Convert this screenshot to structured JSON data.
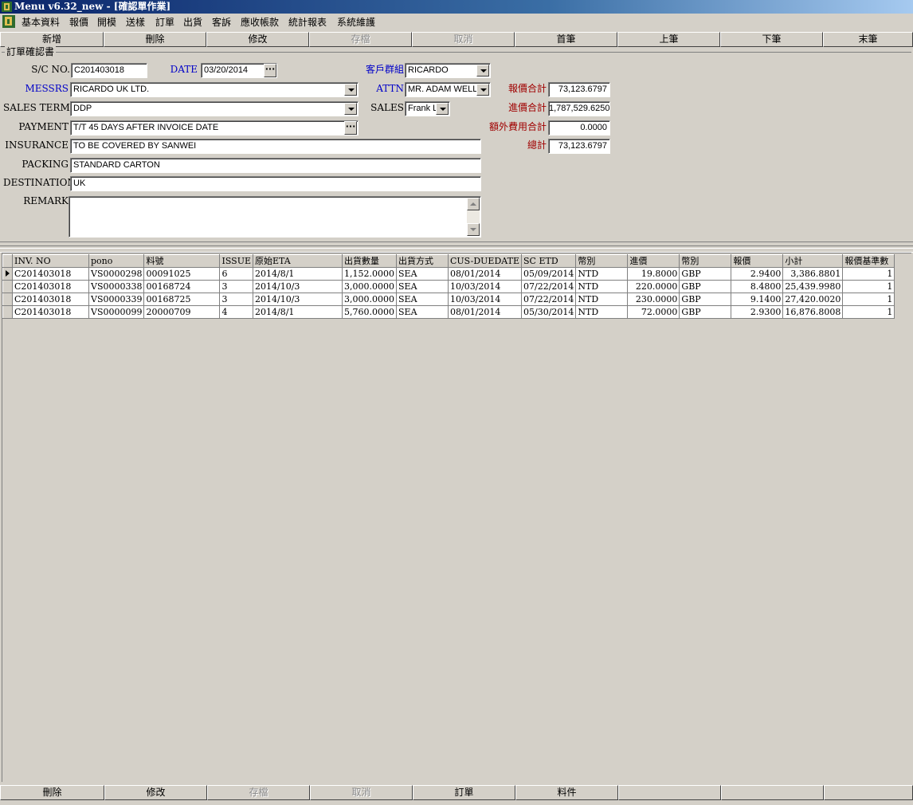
{
  "window": {
    "title": "Menu v6.32_new - [確認單作業]"
  },
  "menu": [
    "基本資料",
    "報價",
    "開模",
    "送樣",
    "訂單",
    "出貨",
    "客訴",
    "應收帳款",
    "統計報表",
    "系統維護"
  ],
  "toolbar": [
    {
      "label": "新增",
      "enabled": true
    },
    {
      "label": "刪除",
      "enabled": true
    },
    {
      "label": "修改",
      "enabled": true
    },
    {
      "label": "存檔",
      "enabled": false
    },
    {
      "label": "取消",
      "enabled": false
    },
    {
      "label": "首筆",
      "enabled": true
    },
    {
      "label": "上筆",
      "enabled": true
    },
    {
      "label": "下筆",
      "enabled": true
    },
    {
      "label": "末筆",
      "enabled": true
    }
  ],
  "form": {
    "group_title": "訂單確認書",
    "sc_no_label": "S/C NO.",
    "sc_no": "C201403018",
    "date_label": "DATE",
    "date": "03/20/2014",
    "customer_group_label": "客戶群組",
    "customer_group": "RICARDO",
    "messrs_label": "MESSRS",
    "messrs": "RICARDO UK LTD.",
    "attn_label": "ATTN",
    "attn": "MR. ADAM WELL",
    "sales_terms_label": "SALES TERMS",
    "sales_terms": "DDP",
    "sales_label": "SALES",
    "sales": "Frank L",
    "payment_label": "PAYMENT",
    "payment": "T/T 45 DAYS AFTER INVOICE DATE",
    "insurance_label": "INSURANCE",
    "insurance": "TO BE COVERED BY SANWEI",
    "packing_label": "PACKING",
    "packing": "STANDARD CARTON",
    "destination_label": "DESTINATION",
    "destination": "UK",
    "remark_label": "REMARK",
    "remark": ""
  },
  "totals": {
    "quote_total_label": "報價合計",
    "quote_total": "73,123.6797",
    "cost_total_label": "進價合計",
    "cost_total": "1,787,529.6250",
    "extra_fee_label": "額外費用合計",
    "extra_fee": "0.0000",
    "grand_total_label": "總計",
    "grand_total": "73,123.6797"
  },
  "grid": {
    "columns": [
      "INV. NO",
      "pono",
      "料號",
      "ISSUE",
      "原始ETA",
      "出貨數量",
      "出貨方式",
      "CUS-DUEDATE",
      "SC ETD",
      "幣別",
      "進價",
      "幣別",
      "報價",
      "小計",
      "報價基準數"
    ],
    "rows": [
      [
        "C201403018",
        "VS0000298",
        "00091025",
        "6",
        "2014/8/1",
        "1,152.0000",
        "SEA",
        "08/01/2014",
        "05/09/2014",
        "NTD",
        "19.8000",
        "GBP",
        "2.9400",
        "3,386.8801",
        "1"
      ],
      [
        "C201403018",
        "VS0000338",
        "00168724",
        "3",
        "2014/10/3",
        "3,000.0000",
        "SEA",
        "10/03/2014",
        "07/22/2014",
        "NTD",
        "220.0000",
        "GBP",
        "8.4800",
        "25,439.9980",
        "1"
      ],
      [
        "C201403018",
        "VS0000339",
        "00168725",
        "3",
        "2014/10/3",
        "3,000.0000",
        "SEA",
        "10/03/2014",
        "07/22/2014",
        "NTD",
        "230.0000",
        "GBP",
        "9.1400",
        "27,420.0020",
        "1"
      ],
      [
        "C201403018",
        "VS0000099",
        "20000709",
        "4",
        "2014/8/1",
        "5,760.0000",
        "SEA",
        "08/01/2014",
        "05/30/2014",
        "NTD",
        "72.0000",
        "GBP",
        "2.9300",
        "16,876.8008",
        "1"
      ]
    ]
  },
  "bottom_toolbar": [
    {
      "label": "刪除",
      "enabled": true
    },
    {
      "label": "修改",
      "enabled": true
    },
    {
      "label": "存檔",
      "enabled": false
    },
    {
      "label": "取消",
      "enabled": false
    },
    {
      "label": "訂單",
      "enabled": true
    },
    {
      "label": "料件",
      "enabled": true
    },
    {
      "label": "",
      "enabled": true
    },
    {
      "label": "",
      "enabled": true
    },
    {
      "label": "",
      "enabled": true
    }
  ]
}
